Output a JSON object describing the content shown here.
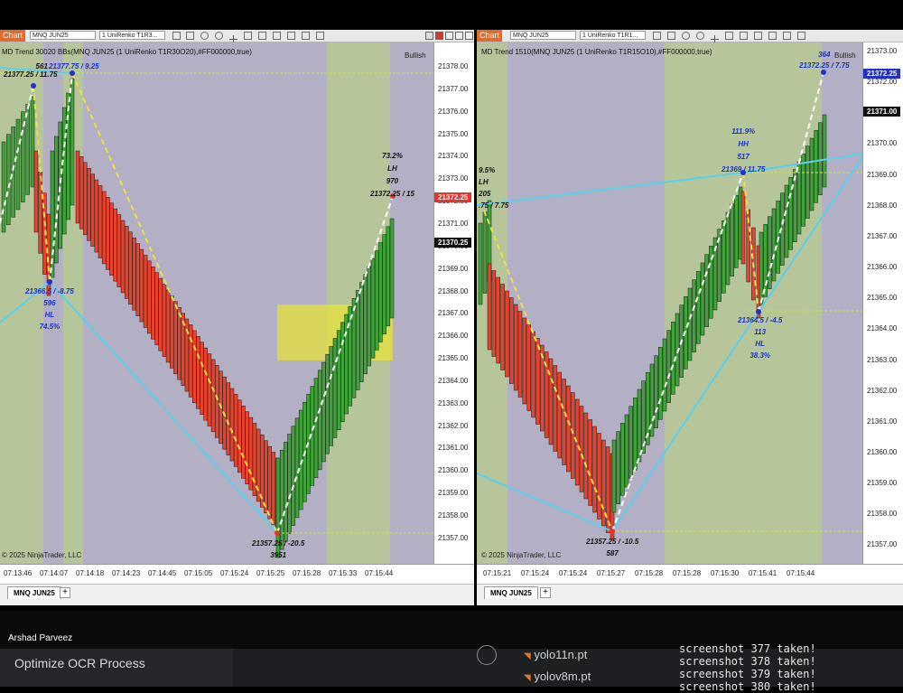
{
  "left_pane": {
    "toolbar": {
      "chart_label": "Chart",
      "instrument": "MNQ JUN25",
      "bar_type": "1 UniRenko T1R3..."
    },
    "title": "MD Trend 30020 BBs(MNQ JUN25 (1 UniRenko T1R30O20),#FF000000,true)",
    "bias": "Bullish",
    "copyright": "© 2025 NinjaTrader, LLC",
    "y_ticks": [
      "21378.00",
      "21377.00",
      "21376.00",
      "21375.00",
      "21374.00",
      "21373.00",
      "21372.00",
      "21371.00",
      "21370.00",
      "21369.00",
      "21368.00",
      "21367.00",
      "21366.00",
      "21365.00",
      "21364.00",
      "21363.00",
      "21362.00",
      "21361.00",
      "21360.00",
      "21359.00",
      "21358.00",
      "21357.00"
    ],
    "x_ticks": [
      "07:13:46",
      "07:14:07",
      "07:14:18",
      "07:14:23",
      "07:14:45",
      "07:15:05",
      "07:15:24",
      "07:15:25",
      "07:15:28",
      "07:15:33",
      "07:15:44"
    ],
    "price_tags": [
      {
        "text": "21372.25",
        "color": "#e8332b"
      },
      {
        "text": "21370.25",
        "color": "#111111"
      }
    ],
    "annotations": {
      "top_left": {
        "l1": "561",
        "l2": "21377.25 / 11.75"
      },
      "top_mid": {
        "l1": "21377.75 / 9.25"
      },
      "low_left": {
        "l1": "21366.5 / -8.75",
        "l2": "596",
        "l3": "HL",
        "l4": "74.5%"
      },
      "high_right": {
        "l1": "73.2%",
        "l2": "LH",
        "l3": "970",
        "l4": "21372.25 / 15"
      },
      "bottom": {
        "l1": "21357.25 / -20.5",
        "l2": "3951"
      }
    },
    "tab": "MNQ JUN25"
  },
  "right_pane": {
    "toolbar": {
      "chart_label": "Chart",
      "instrument": "MNQ JUN25",
      "bar_type": "1 UniRenko T1R1..."
    },
    "title": "MD Trend 1510(MNQ JUN25 (1 UniRenko T1R15O10),#FF000000,true)",
    "bias": "Bullish",
    "copyright": "© 2025 NinjaTrader, LLC",
    "y_ticks": [
      "21373.00",
      "21372.00",
      "21371.00",
      "21370.00",
      "21369.00",
      "21368.00",
      "21367.00",
      "21366.00",
      "21365.00",
      "21364.00",
      "21363.00",
      "21362.00",
      "21361.00",
      "21360.00",
      "21359.00",
      "21358.00",
      "21357.00"
    ],
    "x_ticks": [
      "07:15:21",
      "07:15:24",
      "07:15:24",
      "07:15:27",
      "07:15:28",
      "07:15:28",
      "07:15:30",
      "07:15:41",
      "07:15:44"
    ],
    "price_tags": [
      {
        "text": "21372.25",
        "color": "#2230c8"
      },
      {
        "text": "21371.00",
        "color": "#111111"
      }
    ],
    "annotations": {
      "left": {
        "l1": "9.5%",
        "l2": "LH",
        "l3": "205",
        "l4": ".75 / 7.75"
      },
      "top": {
        "l1": "364",
        "l2": "21372.25 / 7.75"
      },
      "mid": {
        "l1": "111.9%",
        "l2": "HH",
        "l3": "517",
        "l4": "21369 / 11.75"
      },
      "low": {
        "l1": "21364.5 / -4.5",
        "l2": "113",
        "l3": "HL",
        "l4": "38.3%"
      },
      "bottom": {
        "l1": "21357.25 / -10.5",
        "l2": "587"
      }
    },
    "tab": "MNQ JUN25"
  },
  "taskbar": {
    "user_name": "Arshad Parveez",
    "task_title": "Optimize OCR Process",
    "files": [
      "yolo11n.pt",
      "yolov8m.pt"
    ],
    "terminal_lines": [
      "screenshot 377 taken!",
      "screenshot 378 taken!",
      "screenshot 379 taken!",
      "screenshot 380 taken!"
    ]
  }
}
